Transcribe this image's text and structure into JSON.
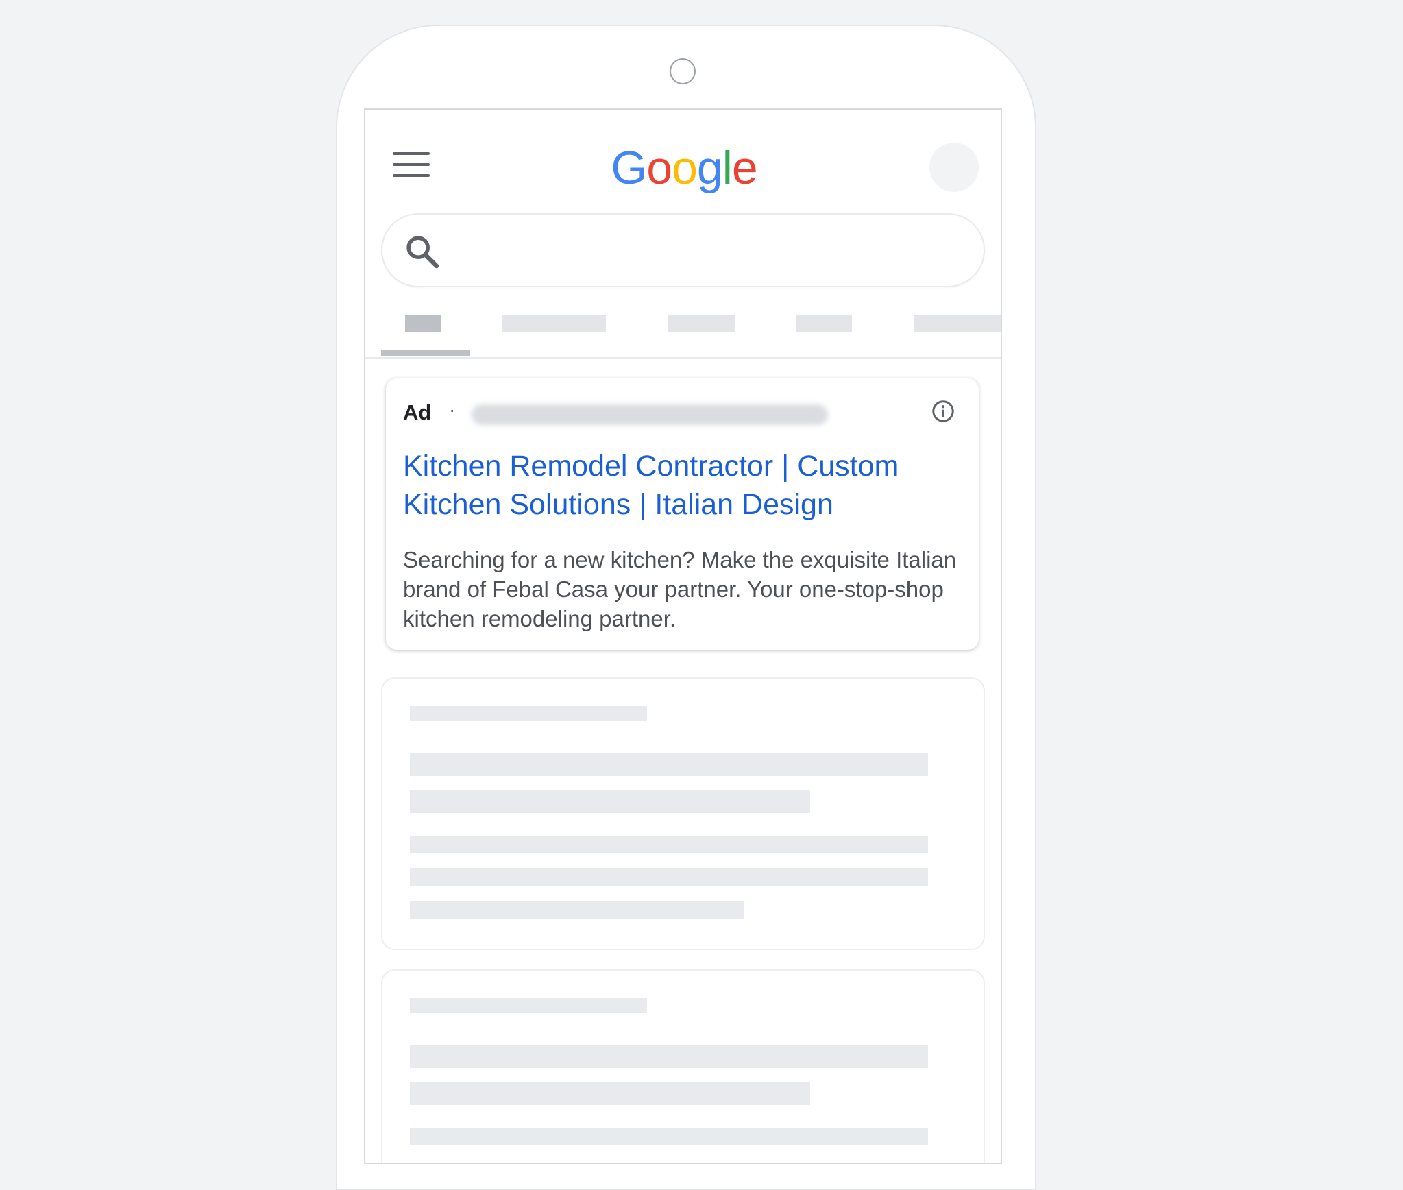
{
  "header": {
    "logo_text": [
      "G",
      "o",
      "o",
      "g",
      "l",
      "e"
    ],
    "logo_colors": [
      "#4285f4",
      "#ea4335",
      "#fbbc05",
      "#4285f4",
      "#34a853",
      "#ea4335"
    ]
  },
  "search": {
    "value": "",
    "placeholder": ""
  },
  "tabs": {
    "count": 5,
    "active_index": 0
  },
  "ad": {
    "label": "Ad",
    "separator": "·",
    "headline": "Kitchen Remodel Contractor | Custom Kitchen Solutions | Italian Design",
    "description": "Searching for a new kitchen? Make the exquisite Italian brand of Febal Casa your partner. Your one-stop-shop kitchen remodeling partner.",
    "url_blurred": true
  },
  "colors": {
    "link": "#1a5fd6",
    "body_text": "#4d5156",
    "placeholder_gray": "#e8eaed",
    "page_background": "#f1f3f4"
  },
  "icons": {
    "menu": "hamburger-menu-icon",
    "search": "search-icon",
    "info": "info-icon"
  }
}
